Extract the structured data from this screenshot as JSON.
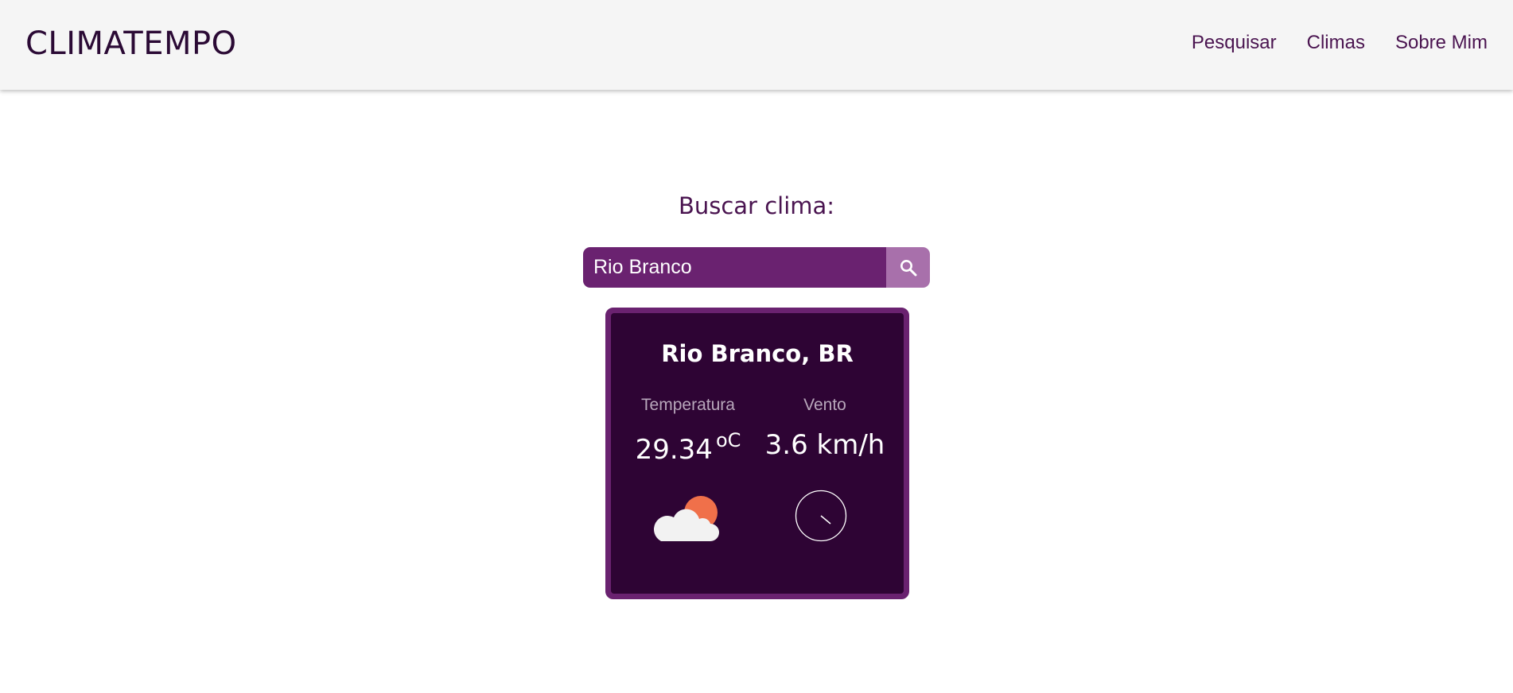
{
  "header": {
    "brand": "CLIMATEMPO",
    "nav": [
      {
        "label": "Pesquisar"
      },
      {
        "label": "Climas"
      },
      {
        "label": "Sobre Mim"
      }
    ]
  },
  "search": {
    "title": "Buscar clima:",
    "value": "Rio Branco",
    "button_icon": "search-icon"
  },
  "weather_card": {
    "city": "Rio Branco, BR",
    "temperature_label": "Temperatura",
    "temperature_value": "29.34",
    "temperature_unit": "oC",
    "wind_label": "Vento",
    "wind_value": "3.6 km/h",
    "weather_icon": "partly-cloudy-icon",
    "wind_icon": "wind-direction-icon"
  },
  "colors": {
    "primary": "#6a2270",
    "card_bg": "#2e0434",
    "search_button": "#a870ab",
    "text_dark": "#4a1450",
    "sun": "#f0704a",
    "cloud": "#f2f2f2"
  }
}
